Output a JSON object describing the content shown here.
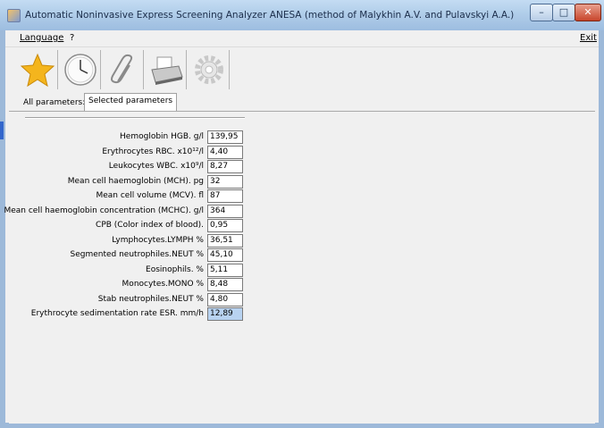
{
  "window": {
    "title": "Automatic Noninvasive Express Screening Analyzer ANESA (method of Malykhin A.V. and Pulavskyi A.A.)",
    "controls": {
      "minimize": "–",
      "maximize": "□",
      "close": "✕"
    }
  },
  "menu": {
    "language": "Language",
    "help": "?",
    "exit": "Exit"
  },
  "toolbar": {
    "buttons": [
      {
        "icon": "star-icon"
      },
      {
        "icon": "clock-icon"
      },
      {
        "icon": "paperclip-icon"
      },
      {
        "icon": "printer-icon"
      },
      {
        "icon": "gear-icon"
      }
    ]
  },
  "tabs": {
    "all": "All parameters:",
    "selected": "Selected parameters"
  },
  "parameters": [
    {
      "label": "Hemoglobin HGB. g/l",
      "value": "139,95"
    },
    {
      "label": "Erythrocytes RBC. x10¹²/l",
      "value": "4,40"
    },
    {
      "label": "Leukocytes WBC. x10⁹/l",
      "value": "8,27"
    },
    {
      "label": "Mean cell haemoglobin (MCH). pg",
      "value": "32"
    },
    {
      "label": "Mean cell volume (MCV). fl",
      "value": "87"
    },
    {
      "label": "Mean cell haemoglobin concentration (MCHC). g/l",
      "value": "364"
    },
    {
      "label": "CPB (Color index of blood).",
      "value": "0,95"
    },
    {
      "label": "Lymphocytes.LYMPH %",
      "value": "36,51"
    },
    {
      "label": "Segmented neutrophiles.NEUT %",
      "value": "45,10"
    },
    {
      "label": "Eosinophils. %",
      "value": "5,11"
    },
    {
      "label": "Monocytes.MONO %",
      "value": "8,48"
    },
    {
      "label": "Stab neutrophiles.NEUT %",
      "value": "4,80"
    },
    {
      "label": "Erythrocyte sedimentation rate ESR. mm/h",
      "value": "12,89"
    }
  ]
}
